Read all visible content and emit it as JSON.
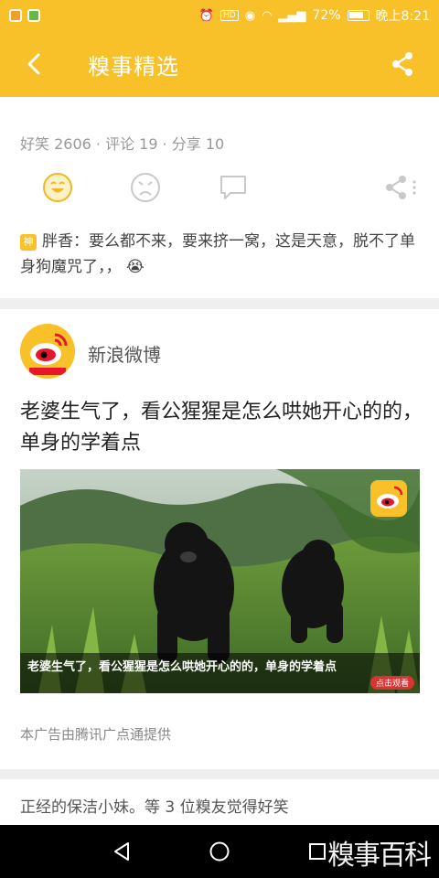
{
  "status_bar": {
    "battery": "72%",
    "time": "晚上8:21",
    "icons": [
      "video-app-icon",
      "mini-app-icon",
      "alarm-icon",
      "hd-icon",
      "eye-icon",
      "wifi-icon",
      "signal-icon",
      "battery-icon"
    ]
  },
  "app_bar": {
    "title": "糗事精选",
    "icons": [
      "back-arrow-icon",
      "share-icon"
    ]
  },
  "post": {
    "stats": "好笑 2606 · 评论 19 · 分享 10",
    "actions": [
      "laugh-icon",
      "sad-icon",
      "comment-icon",
      "share-more-icon"
    ],
    "god_badge": "神",
    "comment": "胖香：要么都不来，要来挤一窝，这是天意，脱不了单身狗魔咒了，，",
    "comment_emoji": "😭"
  },
  "ad": {
    "source": "新浪微博",
    "headline": "老婆生气了，看公猩猩是怎么哄她开心的的，单身的学着点",
    "image_caption": "老婆生气了，看公猩猩是怎么哄她开心的的，单身的学着点",
    "click_label": "点击观看",
    "note": "本广告由腾讯广点通提供"
  },
  "next_post": {
    "text": "正经的保洁小妹。等 3 位糗友觉得好笑"
  },
  "nav_bar": {
    "buttons": [
      "back-triangle-icon",
      "home-circle-icon",
      "recents-square-icon"
    ],
    "watermark": "糗事百科"
  },
  "colors": {
    "accent": "#f8c12a",
    "muted_text": "#999999"
  }
}
